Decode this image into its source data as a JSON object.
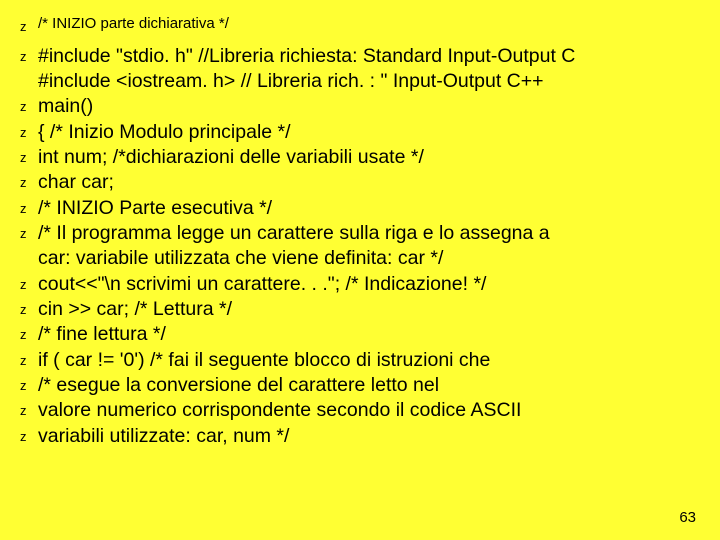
{
  "lines": {
    "l01": "/* INIZIO parte dichiarativa */",
    "l02": "#include \"stdio. h\"  //Libreria richiesta: Standard Input-Output C",
    "l02b": "#include <iostream. h> // Libreria rich. : \"     Input-Output C++",
    "l03": "main()",
    "l04": " { /* Inizio Modulo principale */",
    "l05": " int num;   /*dichiarazioni delle variabili usate */",
    "l06": " char car;",
    "l07": "          /*  INIZIO Parte esecutiva */",
    "l08": "/* Il programma legge un carattere sulla riga e lo assegna a",
    "l08b": "car: variabile utilizzata che viene definita: car */",
    "l09": "        cout<<\"\\n scrivimi un carattere. . .\"; /* Indicazione! */",
    "l10": "        cin >> car;  /* Lettura */",
    "l11": "/* fine lettura */",
    "l12": "      if ( car != '0')  /* fai il seguente blocco di istruzioni che",
    "l13": "       /* esegue la conversione del carattere letto nel",
    "l14": "       valore numerico corrispondente secondo il codice ASCII",
    "l15": "        variabili utilizzate: car, num */"
  },
  "bullet_glyph": "z",
  "page_number": "63"
}
